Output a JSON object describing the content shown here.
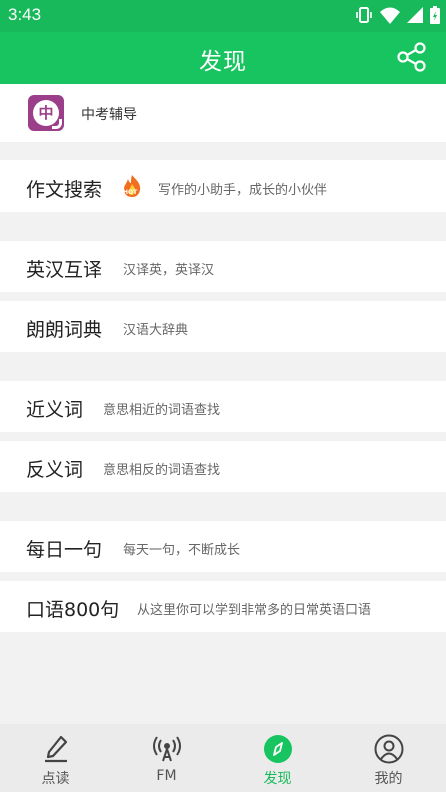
{
  "status_bar": {
    "time": "3:43",
    "icons": [
      "vibrate-icon",
      "wifi-icon",
      "signal-icon",
      "battery-charging-icon"
    ]
  },
  "app_bar": {
    "title": "发现",
    "share_icon": "share-icon"
  },
  "banner": {
    "title": "中考辅导",
    "logo_char": "中"
  },
  "items": [
    {
      "label": "作文搜索",
      "desc": "写作的小助手，成长的小伙伴",
      "badge": "HOT"
    },
    {
      "label": "英汉互译",
      "desc": "汉译英，英译汉"
    },
    {
      "label": "朗朗词典",
      "desc": "汉语大辞典"
    },
    {
      "label": "近义词",
      "desc": "意思相近的词语查找"
    },
    {
      "label": "反义词",
      "desc": "意思相反的词语查找"
    },
    {
      "label": "每日一句",
      "desc": "每天一句，不断成长"
    },
    {
      "label": "口语800句",
      "desc": "从这里你可以学到非常多的日常英语口语"
    }
  ],
  "tabs": [
    {
      "label": "点读",
      "icon": "pen-icon",
      "active": false
    },
    {
      "label": "FM",
      "icon": "radio-icon",
      "active": false
    },
    {
      "label": "发现",
      "icon": "compass-icon",
      "active": true
    },
    {
      "label": "我的",
      "icon": "user-icon",
      "active": false
    }
  ],
  "colors": {
    "brand_green": "#17c45f",
    "status_bar_green": "#17b95a",
    "logo_purple": "#9b3f8a",
    "hot_orange": "#f26d1f"
  }
}
